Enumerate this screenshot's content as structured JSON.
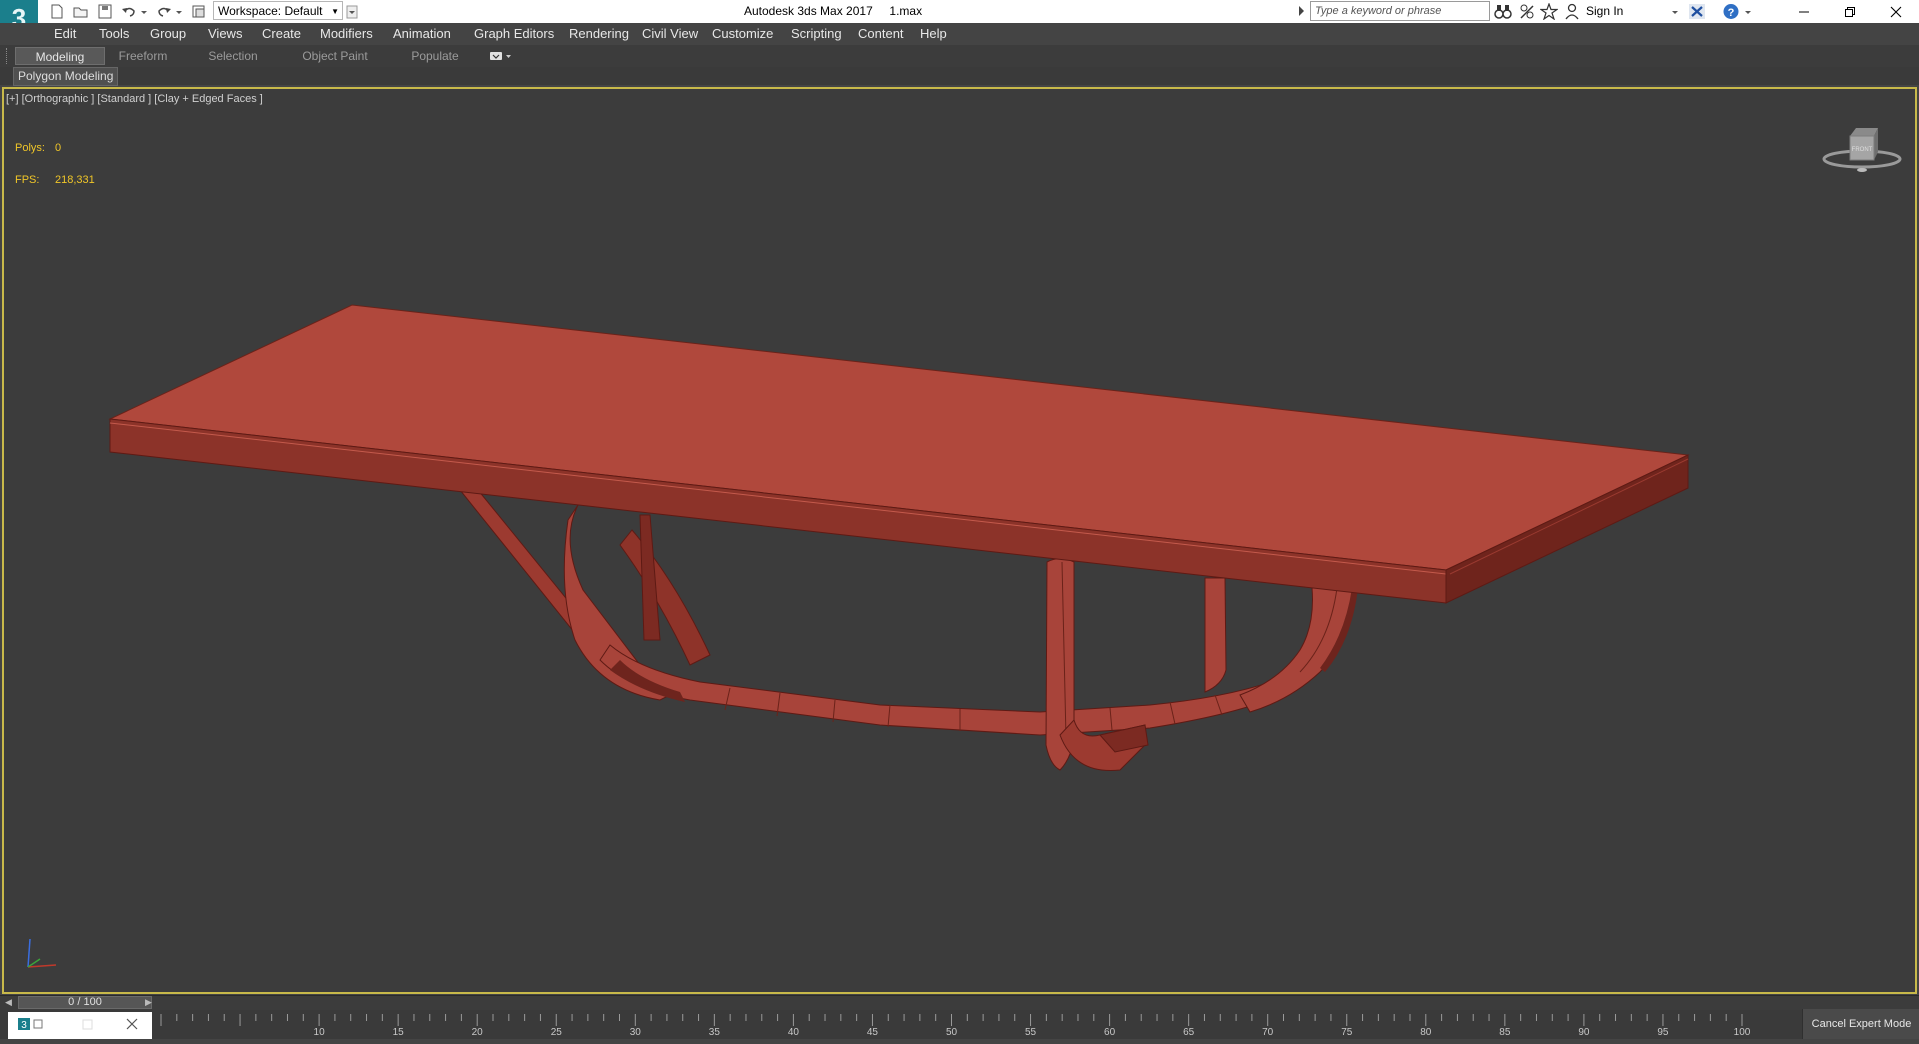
{
  "titlebar": {
    "workspace_label": "Workspace: Default",
    "app_title": "Autodesk 3ds Max 2017",
    "file_name": "1.max",
    "search_placeholder": "Type a keyword or phrase",
    "sign_in": "Sign In"
  },
  "menu": {
    "items": [
      "Edit",
      "Tools",
      "Group",
      "Views",
      "Create",
      "Modifiers",
      "Animation",
      "Graph Editors",
      "Rendering",
      "Civil View",
      "Customize",
      "Scripting",
      "Content",
      "Help"
    ]
  },
  "ribbon": {
    "tabs": [
      "Modeling",
      "Freeform",
      "Selection",
      "Object Paint",
      "Populate"
    ],
    "active_tab": "Modeling",
    "panel_label": "Polygon Modeling"
  },
  "viewport": {
    "label": "[+] [Orthographic ] [Standard ] [Clay + Edged Faces ]",
    "stats": {
      "polys_label": "Polys:",
      "polys_value": "0",
      "fps_label": "FPS:",
      "fps_value": "218,331"
    },
    "viewcube_face": "FRONT",
    "model_color": "#b0483c"
  },
  "timeline": {
    "frame_display": "0 / 100",
    "ticks": [
      "10",
      "15",
      "20",
      "25",
      "30",
      "35",
      "40",
      "45",
      "50",
      "55",
      "60",
      "65",
      "70",
      "75",
      "80",
      "85",
      "90",
      "95",
      "100"
    ],
    "cancel_expert_label": "Cancel Expert Mode"
  },
  "colors": {
    "viewport_border": "#c8b94a",
    "stat_text": "#f0c628",
    "ui_background": "#444444"
  }
}
